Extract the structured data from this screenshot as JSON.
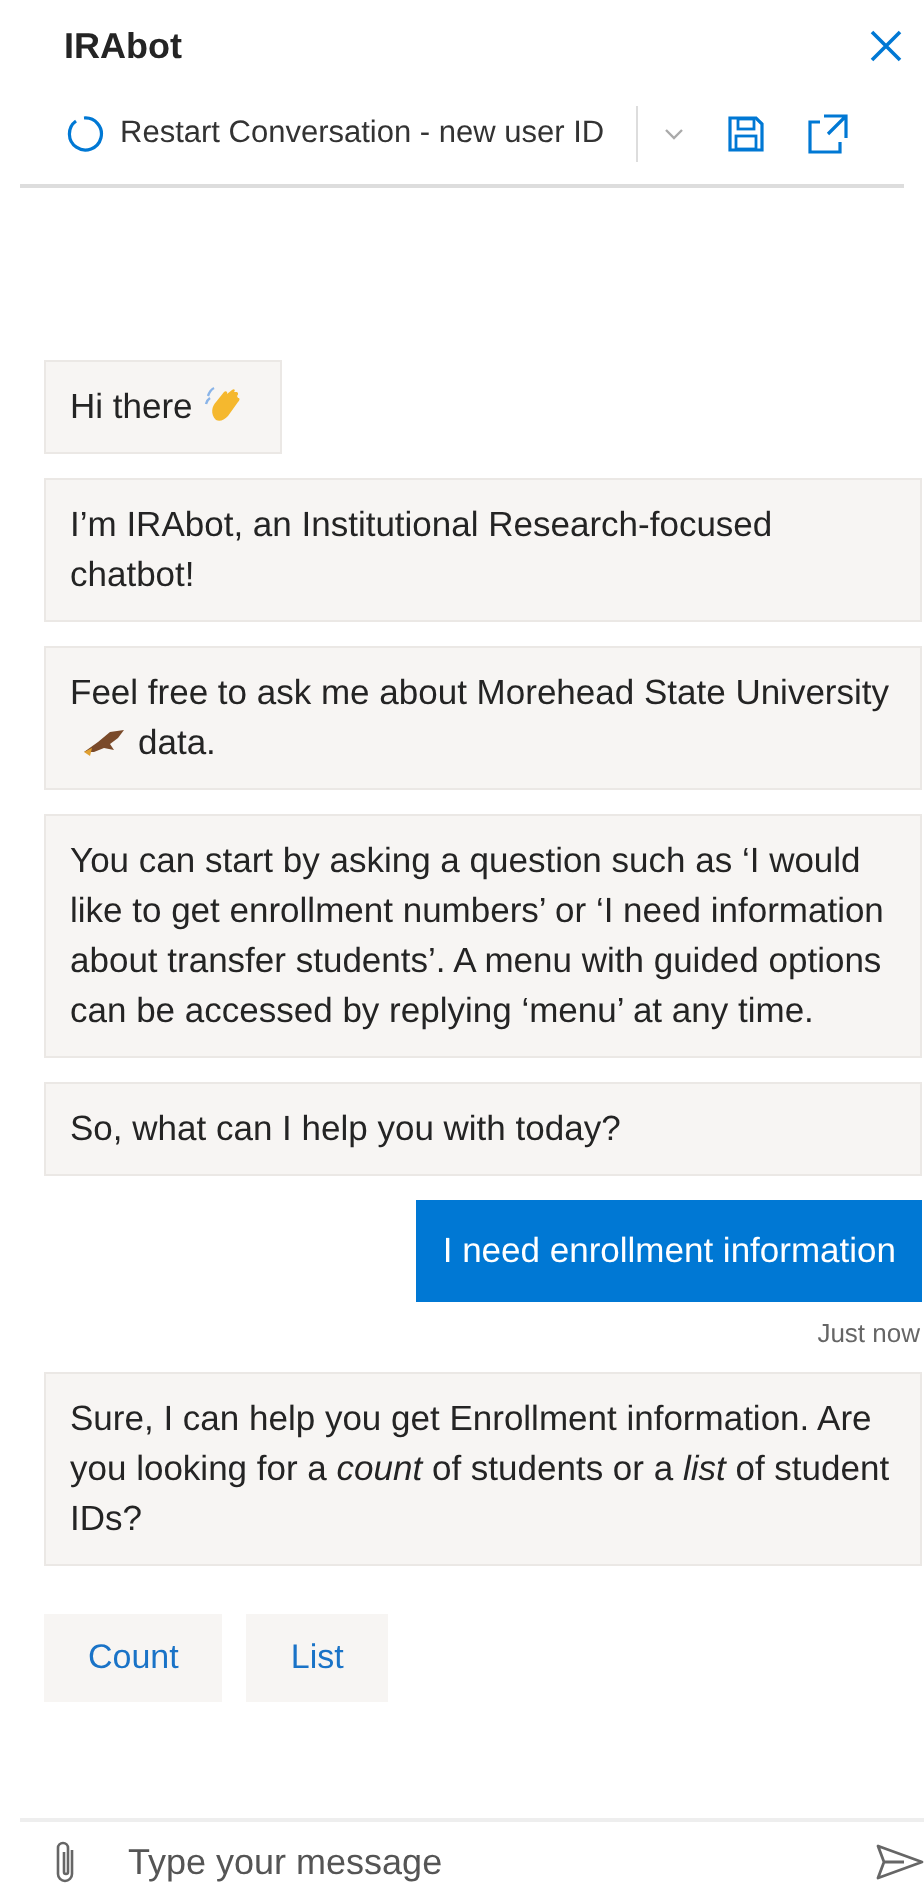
{
  "header": {
    "title": "IRAbot"
  },
  "toolbar": {
    "restart_label": "Restart Conversation - new user ID"
  },
  "messages": [
    {
      "kind": "bot",
      "parts": [
        {
          "kind": "text",
          "text": "Hi there"
        },
        {
          "kind": "wave"
        }
      ]
    },
    {
      "kind": "bot",
      "parts": [
        {
          "kind": "text",
          "text": "I’m IRAbot, an Institutional Research-focused chatbot!"
        }
      ]
    },
    {
      "kind": "bot",
      "parts": [
        {
          "kind": "text",
          "text": "Feel free to ask me about Morehead State University"
        },
        {
          "kind": "bird"
        },
        {
          "kind": "text",
          "text": "data."
        }
      ]
    },
    {
      "kind": "bot",
      "parts": [
        {
          "kind": "text",
          "text": "You can start by asking a question such as ‘I would like to get enrollment numbers’ or ‘I need information about transfer students’. A menu with guided options can be accessed by replying ‘menu’ at any time."
        }
      ]
    },
    {
      "kind": "bot",
      "parts": [
        {
          "kind": "text",
          "text": "So, what can I help you with today?"
        }
      ]
    },
    {
      "kind": "user",
      "parts": [
        {
          "kind": "text",
          "text": "I need enrollment information"
        }
      ],
      "time": "Just now"
    },
    {
      "kind": "bot",
      "parts": [
        {
          "kind": "text",
          "text": "Sure, I can help you get Enrollment information. Are you looking for a *count* of students or a *list* of student IDs?"
        }
      ]
    }
  ],
  "suggested_actions": [
    "Count",
    "List"
  ],
  "composer": {
    "placeholder": "Type your message"
  }
}
